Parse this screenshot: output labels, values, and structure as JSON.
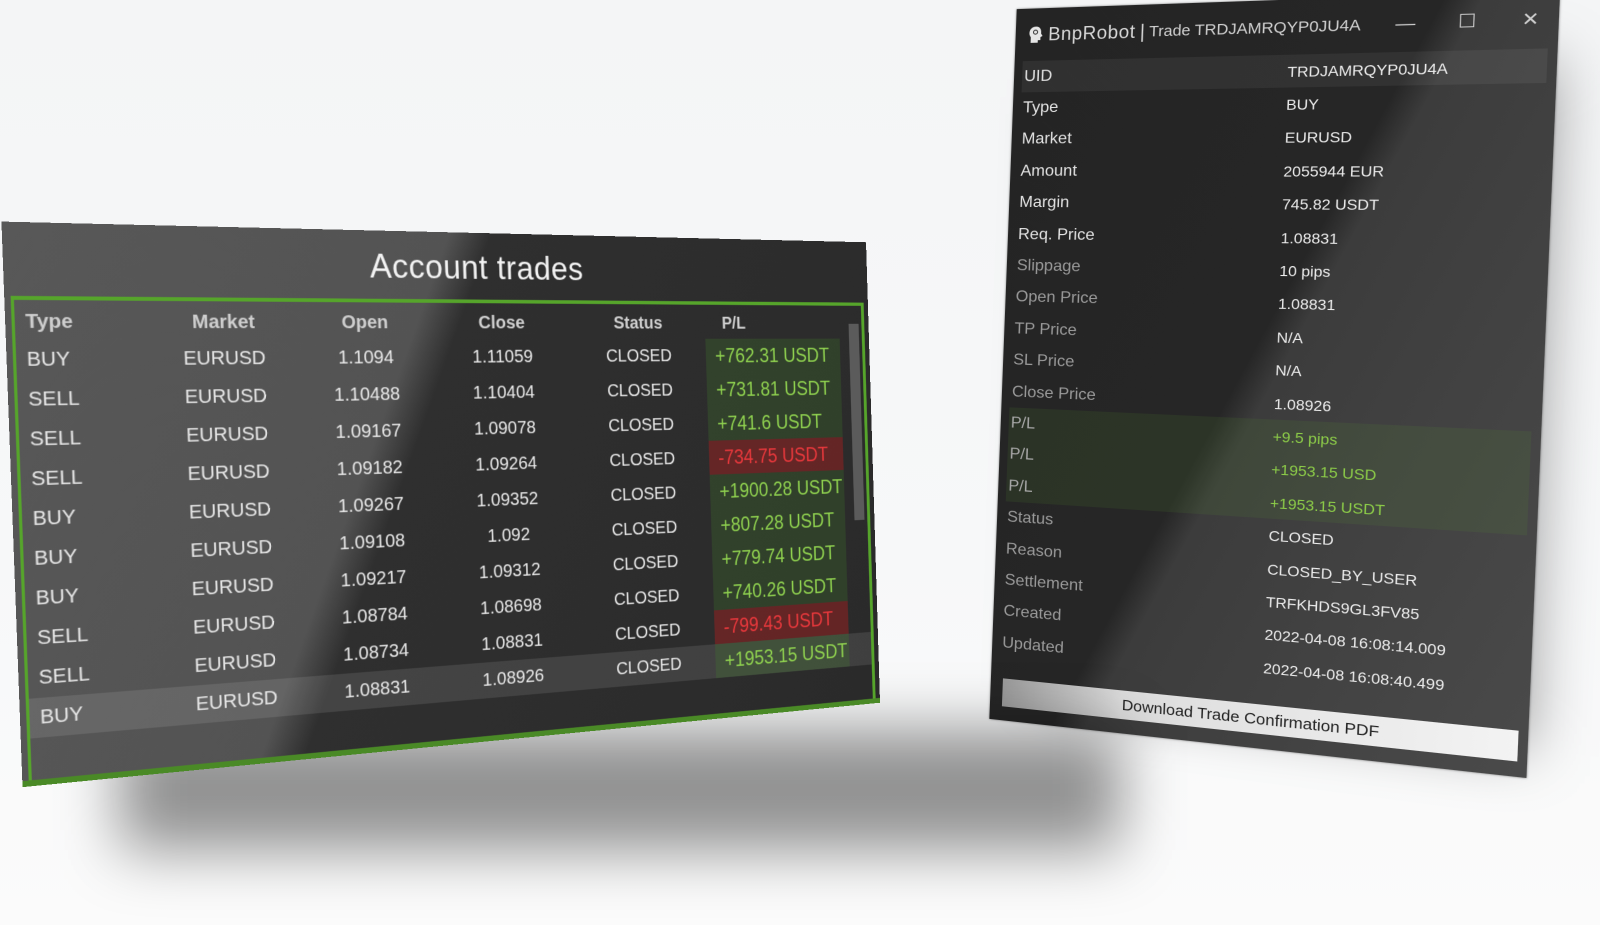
{
  "detail_window": {
    "app_name": "BnpRobot",
    "separator": "|",
    "window_title": "Trade TRDJAMRQYP0JU4A",
    "controls": {
      "minimize": "—",
      "maximize": "☐",
      "close": "✕"
    },
    "properties": [
      {
        "label": "UID",
        "value": "TRDJAMRQYP0JU4A",
        "style": "hl"
      },
      {
        "label": "Type",
        "value": "BUY",
        "style": ""
      },
      {
        "label": "Market",
        "value": "EURUSD",
        "style": ""
      },
      {
        "label": "Amount",
        "value": "2055944 EUR",
        "style": ""
      },
      {
        "label": "Margin",
        "value": "745.82 USDT",
        "style": ""
      },
      {
        "label": "Req. Price",
        "value": "1.08831",
        "style": ""
      },
      {
        "label": "Slippage",
        "value": "10 pips",
        "style": "dim"
      },
      {
        "label": "Open Price",
        "value": "1.08831",
        "style": "dim"
      },
      {
        "label": "TP Price",
        "value": "N/A",
        "style": "dim"
      },
      {
        "label": "SL Price",
        "value": "N/A",
        "style": "dim"
      },
      {
        "label": "Close Price",
        "value": "1.08926",
        "style": "dim"
      },
      {
        "label": "P/L",
        "value": "+9.5 pips",
        "style": "green"
      },
      {
        "label": "P/L",
        "value": "+1953.15 USD",
        "style": "green"
      },
      {
        "label": "P/L",
        "value": "+1953.15 USDT",
        "style": "green"
      },
      {
        "label": "Status",
        "value": "CLOSED",
        "style": "dim"
      },
      {
        "label": "Reason",
        "value": "CLOSED_BY_USER",
        "style": "dim"
      },
      {
        "label": "Settlement",
        "value": "TRFKHDS9GL3FV85",
        "style": "dim"
      },
      {
        "label": "Created",
        "value": "2022-04-08 16:08:14.009",
        "style": "dim"
      },
      {
        "label": "Updated",
        "value": "2022-04-08 16:08:40.499",
        "style": "dim"
      }
    ],
    "download_button": "Download Trade Confirmation PDF"
  },
  "trades_panel": {
    "title": "Account trades",
    "columns": [
      "Type",
      "Market",
      "Open",
      "Close",
      "Status",
      "P/L"
    ],
    "rows": [
      {
        "type": "BUY",
        "market": "EURUSD",
        "open": "1.1094",
        "close": "1.11059",
        "status": "CLOSED",
        "pl": "+762.31 USDT",
        "sign": "pos"
      },
      {
        "type": "SELL",
        "market": "EURUSD",
        "open": "1.10488",
        "close": "1.10404",
        "status": "CLOSED",
        "pl": "+731.81 USDT",
        "sign": "pos"
      },
      {
        "type": "SELL",
        "market": "EURUSD",
        "open": "1.09167",
        "close": "1.09078",
        "status": "CLOSED",
        "pl": "+741.6 USDT",
        "sign": "pos"
      },
      {
        "type": "SELL",
        "market": "EURUSD",
        "open": "1.09182",
        "close": "1.09264",
        "status": "CLOSED",
        "pl": "-734.75 USDT",
        "sign": "neg"
      },
      {
        "type": "BUY",
        "market": "EURUSD",
        "open": "1.09267",
        "close": "1.09352",
        "status": "CLOSED",
        "pl": "+1900.28 USDT",
        "sign": "pos"
      },
      {
        "type": "BUY",
        "market": "EURUSD",
        "open": "1.09108",
        "close": "1.092",
        "status": "CLOSED",
        "pl": "+807.28 USDT",
        "sign": "pos"
      },
      {
        "type": "BUY",
        "market": "EURUSD",
        "open": "1.09217",
        "close": "1.09312",
        "status": "CLOSED",
        "pl": "+779.74 USDT",
        "sign": "pos"
      },
      {
        "type": "SELL",
        "market": "EURUSD",
        "open": "1.08784",
        "close": "1.08698",
        "status": "CLOSED",
        "pl": "+740.26 USDT",
        "sign": "pos"
      },
      {
        "type": "SELL",
        "market": "EURUSD",
        "open": "1.08734",
        "close": "1.08831",
        "status": "CLOSED",
        "pl": "-799.43 USDT",
        "sign": "neg"
      },
      {
        "type": "BUY",
        "market": "EURUSD",
        "open": "1.08831",
        "close": "1.08926",
        "status": "CLOSED",
        "pl": "+1953.15 USDT",
        "sign": "pos",
        "selected": true
      }
    ]
  },
  "colors": {
    "profit": "#8fd14f",
    "loss": "#e8383c",
    "accent_border": "#56a52b"
  }
}
